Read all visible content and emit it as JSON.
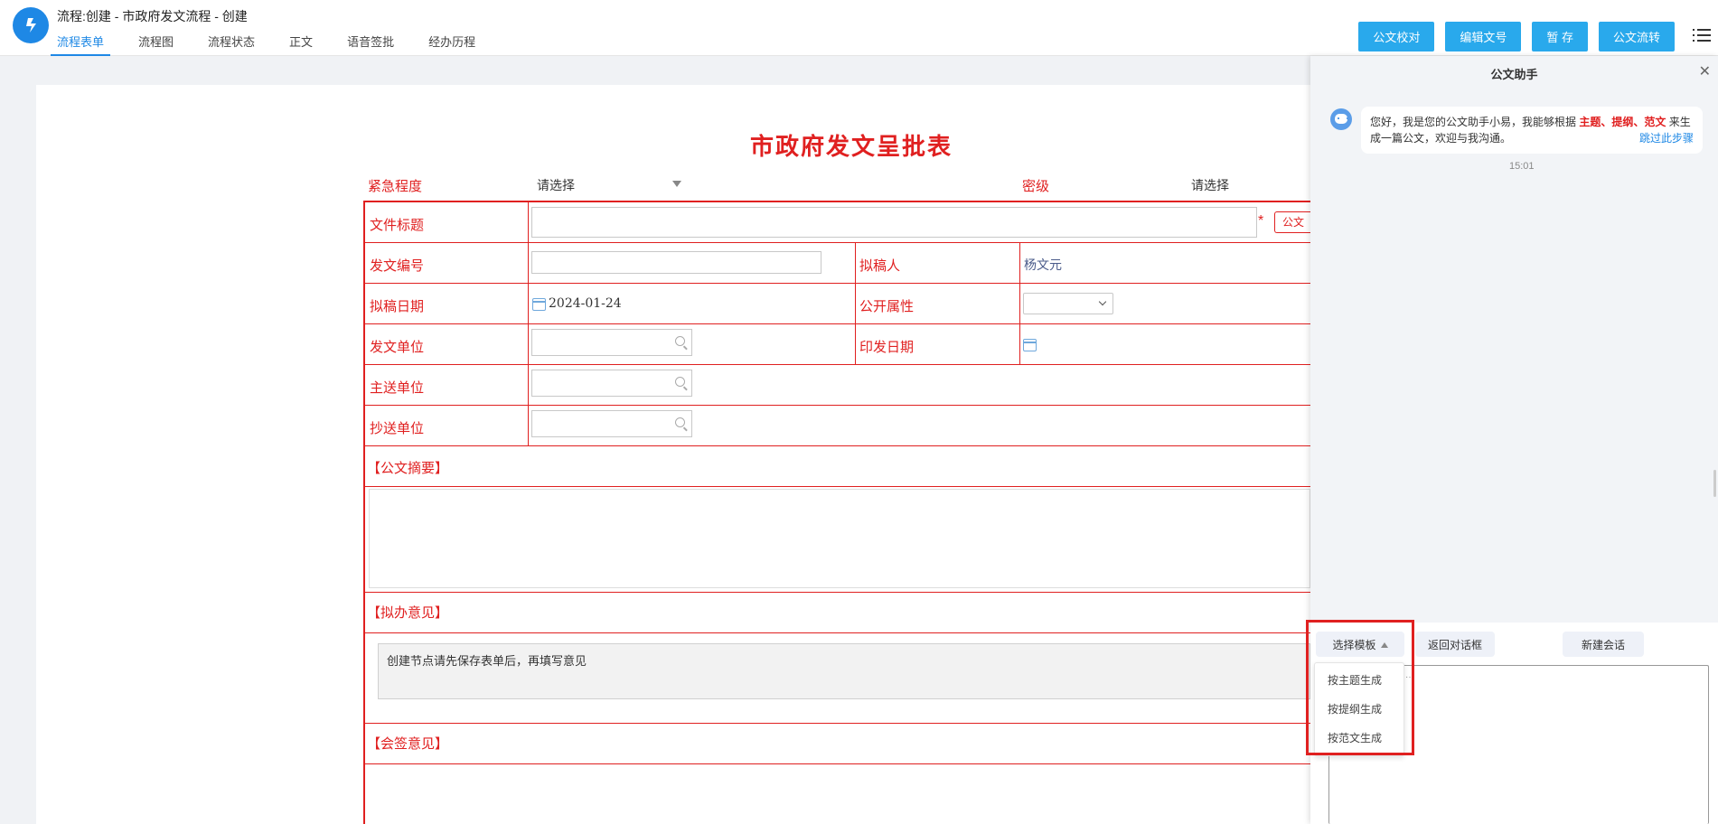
{
  "app": {
    "title": "流程:创建 - 市政府发文流程 - 创建"
  },
  "tabs": [
    {
      "label": "流程表单"
    },
    {
      "label": "流程图"
    },
    {
      "label": "流程状态"
    },
    {
      "label": "正文"
    },
    {
      "label": "语音签批"
    },
    {
      "label": "经办历程"
    }
  ],
  "actions": {
    "proofread": "公文校对",
    "edit_number": "编辑文号",
    "save": "暂 存",
    "flow": "公文流转"
  },
  "form": {
    "title": "市政府发文呈批表",
    "urgency_label": "紧急程度",
    "urgency_value": "请选择",
    "secret_label": "密级",
    "secret_value": "请选择",
    "doc_title_label": "文件标题",
    "doc_title_required": "*",
    "doc_title_btn": "公文",
    "doc_number_label": "发文编号",
    "drafter_label": "拟稿人",
    "drafter_value": "杨文元",
    "draft_date_label": "拟稿日期",
    "draft_date_value": "2024-01-24",
    "public_label": "公开属性",
    "issuer_label": "发文单位",
    "print_date_label": "印发日期",
    "main_recipient_label": "主送单位",
    "cc_label": "抄送单位",
    "summary_label": "【公文摘要】",
    "opinion_label": "【拟办意见】",
    "opinion_hint": "创建节点请先保存表单后，再填写意见",
    "countersign_label": "【会签意见】"
  },
  "assistant": {
    "title": "公文助手",
    "greeting_pre": "您好，我是您的公文助手小易，我能够根据 ",
    "kw1": "主题",
    "sep1": "、",
    "kw2": "提纲",
    "sep2": "、",
    "kw3": "范文",
    "greeting_post": " 来生成一篇公文，欢迎与我沟通。",
    "skip": "跳过此步骤",
    "time": "15:01",
    "template_btn": "选择模板",
    "back_btn": "返回对话框",
    "new_btn": "新建会话",
    "dropdown": [
      {
        "label": "按主题生成"
      },
      {
        "label": "按提纲生成"
      },
      {
        "label": "按范文生成"
      }
    ]
  },
  "colors": {
    "accent": "#1e88e5",
    "button": "#29a9ec",
    "form_red": "#e02020",
    "highlight": "#e02020"
  }
}
